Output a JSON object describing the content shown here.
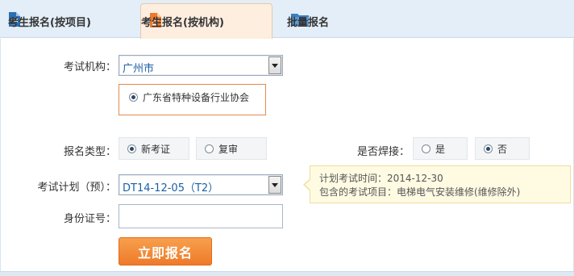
{
  "tabs": [
    {
      "label": "考生报名(按项目)",
      "icon": "document-icon",
      "active": false
    },
    {
      "label": "考生报名(按机构)",
      "icon": "document-icon",
      "active": true
    },
    {
      "label": "批量报名",
      "icon": "folder-icon",
      "active": false
    }
  ],
  "colors": {
    "accent": "#ee7a2a",
    "link": "#1d5f99",
    "tab_active_bg": "#fdeee0"
  },
  "form": {
    "org_label": "考试机构：",
    "org_select_value": "广州市",
    "org_option": "广东省特种设备行业协会",
    "type_label": "报名类型：",
    "type_options": [
      "新考证",
      "复审"
    ],
    "type_selected": "新考证",
    "weld_label": "是否焊接：",
    "weld_options": [
      "是",
      "否"
    ],
    "weld_selected": "否",
    "plan_label": "考试计划（预）：",
    "plan_select_value": "DT14-12-05（T2）",
    "id_label": "身份证号：",
    "id_value": "",
    "submit_label": "立即报名"
  },
  "tooltip": {
    "line1": "计划考试时间：2014-12-30",
    "line2": "包含的考试项目：电梯电气安装维修(维修除外)"
  }
}
